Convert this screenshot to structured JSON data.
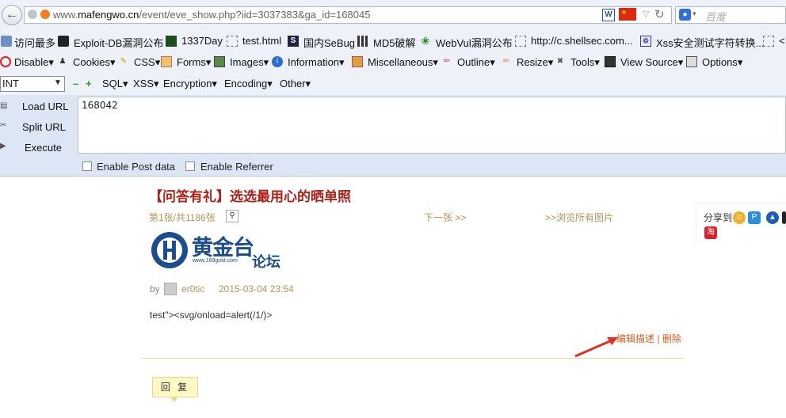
{
  "browser": {
    "url_prefix": "www.",
    "url_domain": "mafengwo.cn",
    "url_path": "/event/eve_show.php?iid=3037383&ga_id=168045",
    "search_placeholder": "百度"
  },
  "bookmarks": [
    {
      "label": "访问最多",
      "icon": "bookmark-icon"
    },
    {
      "label": "Exploit-DB漏洞公布",
      "icon": "exploit-db-icon"
    },
    {
      "label": "1337Day",
      "icon": "1337day-icon"
    },
    {
      "label": "test.html",
      "icon": "page-icon"
    },
    {
      "label": "国内SeBug",
      "icon": "sebug-icon"
    },
    {
      "label": "MD5破解",
      "icon": "md5-icon"
    },
    {
      "label": "WebVul漏洞公布",
      "icon": "webvul-icon"
    },
    {
      "label": "http://c.shellsec.com...",
      "icon": "page-icon"
    },
    {
      "label": "Xss安全测试字符转换...",
      "icon": "xss-icon"
    },
    {
      "label": "<",
      "icon": "page-icon"
    }
  ],
  "webdev_menu": [
    "Disable",
    "Cookies",
    "CSS",
    "Forms",
    "Images",
    "Information",
    "Miscellaneous",
    "Outline",
    "Resize",
    "Tools",
    "View Source",
    "Options"
  ],
  "hackbar": {
    "select_value": "INT",
    "menu": [
      "SQL",
      "XSS",
      "Encryption",
      "Encoding",
      "Other"
    ],
    "load_url": "Load URL",
    "split_url": "Split URL",
    "execute": "Execute",
    "url_value": "168042",
    "enable_post": "Enable Post data",
    "enable_referrer": "Enable Referrer"
  },
  "page": {
    "title": "【问答有礼】选选最用心的晒单照",
    "page_info": "第1张/共1186张",
    "next": "下一张 >>",
    "browse_all": ">>浏览所有图片",
    "share_label": "分享到",
    "logo_main": "黄金台",
    "logo_sub": "论坛",
    "logo_url": "www.169gold.com",
    "by": "by",
    "author": "er0tic",
    "date": "2015-03-04 23:54",
    "post_text": "test\"><svg/onload=alert(/1/)>",
    "edit_desc": "编辑描述",
    "separator": "|",
    "delete": "删除",
    "reply": "回 复"
  },
  "colors": {
    "title": "#b02018",
    "meta": "#b89358",
    "edit": "#e05a20",
    "arrow": "#e03020",
    "toolbar_bg": "#eef2f8",
    "hackbar_panel": "#dce6f4"
  }
}
